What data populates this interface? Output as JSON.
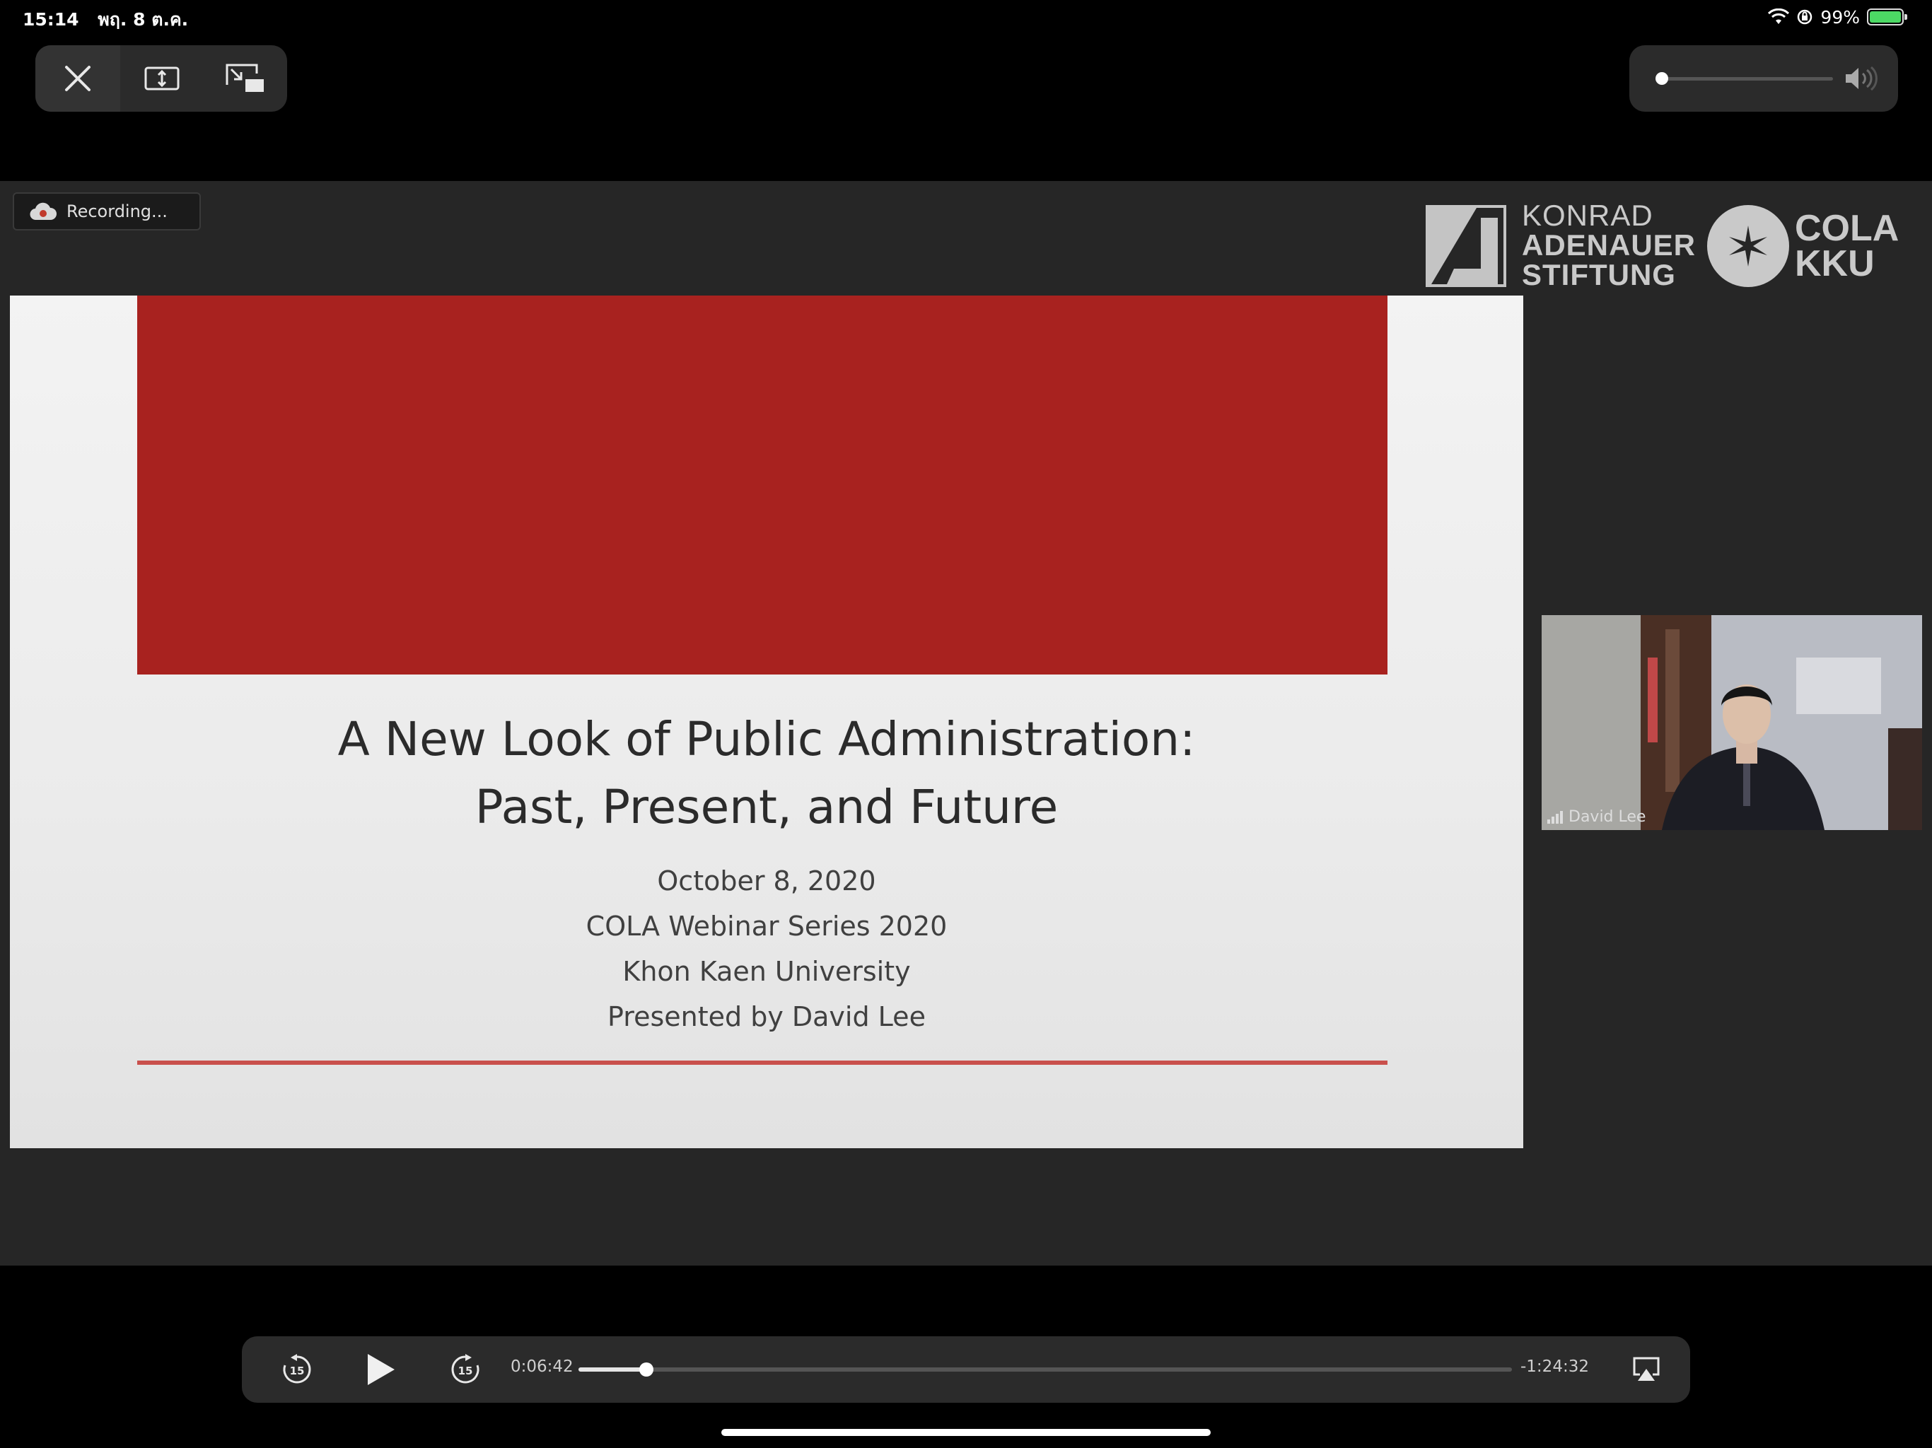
{
  "status_bar": {
    "time": "15:14",
    "date": "พฤ. 8 ต.ค.",
    "battery_percent": "99%",
    "battery_level": 0.99,
    "charging": true
  },
  "top_controls": {
    "close_icon": "close-icon",
    "resize_icon": "aspect-resize-icon",
    "pip_icon": "picture-in-picture-icon"
  },
  "volume": {
    "level": 0.03,
    "icon": "speaker-icon"
  },
  "meeting": {
    "recording_label": "Recording..."
  },
  "logos": {
    "kas_lines": [
      "KONRAD",
      "ADENAUER",
      "STIFTUNG"
    ],
    "cola_lines": [
      "COLA",
      "KKU"
    ]
  },
  "slide": {
    "title_line1": "A New Look of Public Administration:",
    "title_line2": "Past, Present, and Future",
    "date": "October 8, 2020",
    "series": "COLA Webinar Series 2020",
    "institution": "Khon Kaen University",
    "presenter": "Presented by David Lee",
    "band_color": "#a8221f",
    "rule_color": "#c9504c"
  },
  "participant": {
    "name": "David Lee"
  },
  "transport": {
    "skip_back_label": "15",
    "skip_forward_label": "15",
    "elapsed": "0:06:42",
    "remaining": "-1:24:32",
    "progress": 0.073
  }
}
